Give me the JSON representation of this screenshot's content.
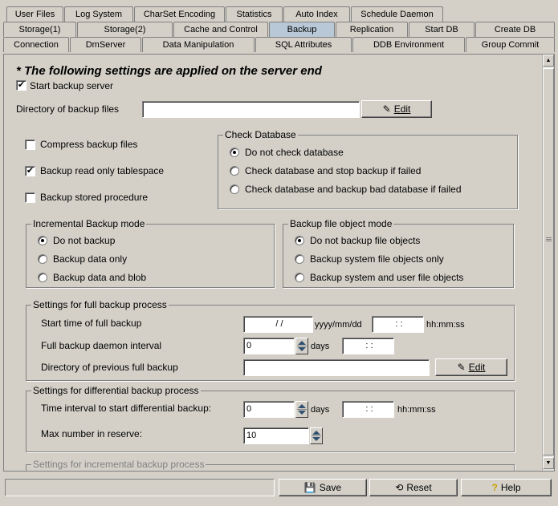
{
  "tabs": {
    "row1": [
      "User Files",
      "Log System",
      "CharSet Encoding",
      "Statistics",
      "Auto Index",
      "Schedule Daemon"
    ],
    "row2": [
      "Storage(1)",
      "Storage(2)",
      "Cache and Control",
      "Backup",
      "Replication",
      "Start DB",
      "Create DB"
    ],
    "row3": [
      "Connection",
      "DmServer",
      "Data Manipulation",
      "SQL Attributes",
      "DDB Environment",
      "Group Commit"
    ],
    "active": "Backup"
  },
  "heading": "* The following settings are applied on the server end",
  "start_backup_server": {
    "label": "Start backup server",
    "checked": true
  },
  "backup_dir": {
    "label": "Directory of backup files",
    "value": "",
    "edit_label": "Edit"
  },
  "compress": {
    "label": "Compress backup files",
    "checked": false
  },
  "readonly_ts": {
    "label": "Backup read only tablespace",
    "checked": true
  },
  "stored_proc": {
    "label": "Backup stored procedure",
    "checked": false
  },
  "check_db": {
    "title": "Check Database",
    "options": [
      "Do not check database",
      "Check database and stop backup if failed",
      "Check database and backup bad database if failed"
    ],
    "selected": "Do not check database"
  },
  "incremental_mode": {
    "title": "Incremental Backup mode",
    "options": [
      "Do not backup",
      "Backup data only",
      "Backup data and blob"
    ],
    "selected": "Do not backup"
  },
  "file_object_mode": {
    "title": "Backup file object mode",
    "options": [
      "Do not backup file objects",
      "Backup system file objects only",
      "Backup system and user file objects"
    ],
    "selected": "Do not backup file objects"
  },
  "full_backup": {
    "title": "Settings for full backup process",
    "start_time_label": "Start time of full backup",
    "date_value": "/ /",
    "date_format": "yyyy/mm/dd",
    "time_value": ": :",
    "time_format": "hh:mm:ss",
    "interval_label": "Full backup daemon interval",
    "interval_value": "0",
    "days_label": "days",
    "interval_time_value": ": :",
    "prev_dir_label": "Directory of previous full backup",
    "prev_dir_value": "",
    "edit_label": "Edit"
  },
  "diff_backup": {
    "title": "Settings for differential backup process",
    "interval_label": "Time interval to start differential backup:",
    "interval_value": "0",
    "days_label": "days",
    "time_value": ": :",
    "time_format": "hh:mm:ss",
    "max_label": "Max number in reserve:",
    "max_value": "10"
  },
  "incr_settings": {
    "title": "Settings for incremental backup process"
  },
  "footer": {
    "save_label": "Save",
    "reset_label": "Reset",
    "help_label": "Help"
  },
  "icons": {
    "edit": "pencil-icon",
    "save": "save-icon",
    "reset": "reset-icon",
    "help": "help-icon"
  }
}
